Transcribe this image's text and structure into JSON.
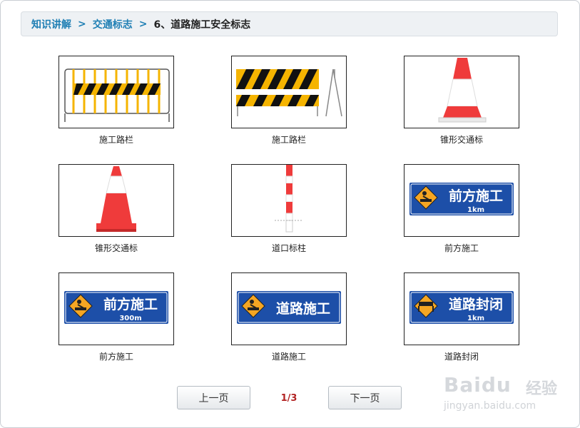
{
  "breadcrumb": {
    "level1": "知识讲解",
    "level2": "交通标志",
    "current": "6、道路施工安全标志",
    "separator": ">"
  },
  "signs": [
    {
      "caption": "施工路栏",
      "type": "barrier-fence"
    },
    {
      "caption": "施工路栏",
      "type": "barrier-board"
    },
    {
      "caption": "锥形交通标",
      "type": "cone-tall"
    },
    {
      "caption": "锥形交通标",
      "type": "cone-short"
    },
    {
      "caption": "道口标柱",
      "type": "post"
    },
    {
      "caption": "前方施工",
      "type": "blue-sign",
      "main": "前方施工",
      "sub": "1km"
    },
    {
      "caption": "前方施工",
      "type": "blue-sign",
      "main": "前方施工",
      "sub": "300m"
    },
    {
      "caption": "道路施工",
      "type": "blue-sign",
      "main": "道路施工",
      "sub": ""
    },
    {
      "caption": "道路封闭",
      "type": "blue-sign",
      "main": "道路封闭",
      "sub": "1km"
    }
  ],
  "pager": {
    "prev_label": "上一页",
    "next_label": "下一页",
    "indicator": "1/3"
  },
  "watermark": {
    "logo": "Baidu",
    "brand": "经验",
    "url": "jingyan.baidu.com"
  },
  "colors": {
    "link": "#1f7fb4",
    "sign_blue": "#1d4fa8",
    "warning_orange": "#f5a623",
    "cone_red": "#ef3b3b",
    "page_indicator": "#b22222"
  }
}
